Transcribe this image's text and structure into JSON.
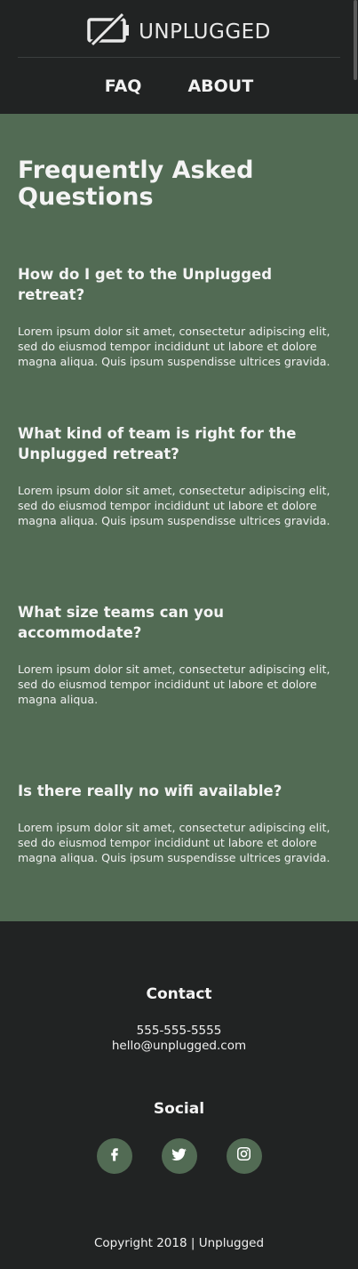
{
  "header": {
    "logo_text": "UNPLUGGED",
    "logo_icon": "battery-off-icon",
    "nav": [
      {
        "label": "FAQ"
      },
      {
        "label": "ABOUT"
      }
    ]
  },
  "main": {
    "title": "Frequently Asked Questions",
    "faqs": [
      {
        "question": "How do I get to the Unplugged retreat?",
        "answer": "Lorem ipsum dolor sit amet, consectetur adipiscing elit, sed do eiusmod tempor incididunt ut labore et dolore magna aliqua. Quis ipsum suspendisse ultrices gravida."
      },
      {
        "question": "What kind of team is right for the Unplugged retreat?",
        "answer": "Lorem ipsum dolor sit amet, consectetur adipiscing elit, sed do eiusmod tempor incididunt ut labore et dolore magna aliqua. Quis ipsum suspendisse ultrices gravida."
      },
      {
        "question": "What size teams can you accommodate?",
        "answer": "Lorem ipsum dolor sit amet, consectetur adipiscing elit, sed do eiusmod tempor incididunt ut labore et dolore magna aliqua."
      },
      {
        "question": "Is there really no wifi available?",
        "answer": "Lorem ipsum dolor sit amet, consectetur adipiscing elit, sed do eiusmod tempor incididunt ut labore et dolore magna aliqua. Quis ipsum suspendisse ultrices gravida."
      }
    ]
  },
  "footer": {
    "contact_heading": "Contact",
    "phone": "555-555-5555",
    "email": "hello@unplugged.com",
    "social_heading": "Social",
    "social": [
      {
        "icon": "facebook-icon"
      },
      {
        "icon": "twitter-icon"
      },
      {
        "icon": "instagram-icon"
      }
    ],
    "copyright": "Copyright 2018 | Unplugged"
  },
  "colors": {
    "dark_bg": "#212323",
    "accent_green": "#526b54",
    "text": "#f4f4f4"
  }
}
